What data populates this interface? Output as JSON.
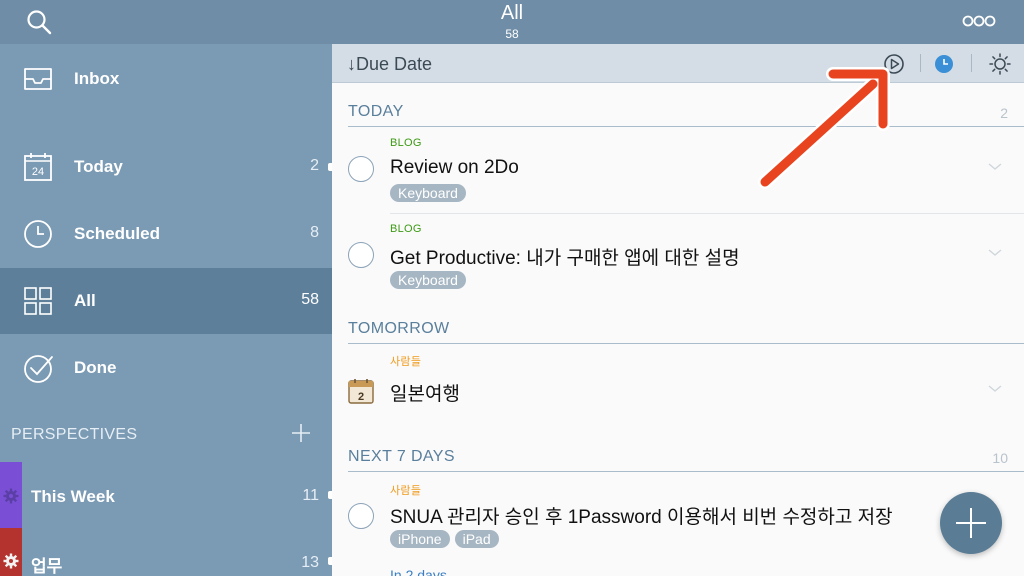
{
  "topbar": {
    "title": "All",
    "count": "58"
  },
  "sidebar": {
    "items": [
      {
        "label": "Inbox",
        "count": ""
      },
      {
        "label": "Today",
        "count": "2"
      },
      {
        "label": "Scheduled",
        "count": "8"
      },
      {
        "label": "All",
        "count": "58"
      },
      {
        "label": "Done",
        "count": ""
      }
    ],
    "perspectives_label": "PERSPECTIVES",
    "perspectives": [
      {
        "label": "This Week",
        "count": "11",
        "color": "#7a4fd6"
      },
      {
        "label": "업무",
        "count": "13",
        "color": "#b5332e"
      }
    ]
  },
  "toolbar": {
    "sort_label": "Due Date"
  },
  "sections": [
    {
      "title": "TODAY",
      "count": "2"
    },
    {
      "title": "TOMORROW",
      "count": ""
    },
    {
      "title": "NEXT 7 DAYS",
      "count": "10"
    }
  ],
  "tasks": [
    {
      "project": "BLOG",
      "name": "Review on 2Do",
      "tags": [
        "Keyboard"
      ]
    },
    {
      "project": "BLOG",
      "name": "Get Productive: 내가 구매한 앱에 대한 설명",
      "tags": [
        "Keyboard"
      ]
    },
    {
      "project": "사람들",
      "name": "일본여행",
      "badge": "2",
      "tags": []
    },
    {
      "project": "사람들",
      "name": "SNUA 관리자 승인 후 1Password 이용해서 비번 수정하고 저장",
      "tags": [
        "iPhone",
        "iPad"
      ]
    }
  ],
  "partial_text": "In 2 days",
  "colors": {
    "accent": "#5a7f9c",
    "sidebar": "#7b9ab3",
    "arrow": "#e8441f"
  }
}
